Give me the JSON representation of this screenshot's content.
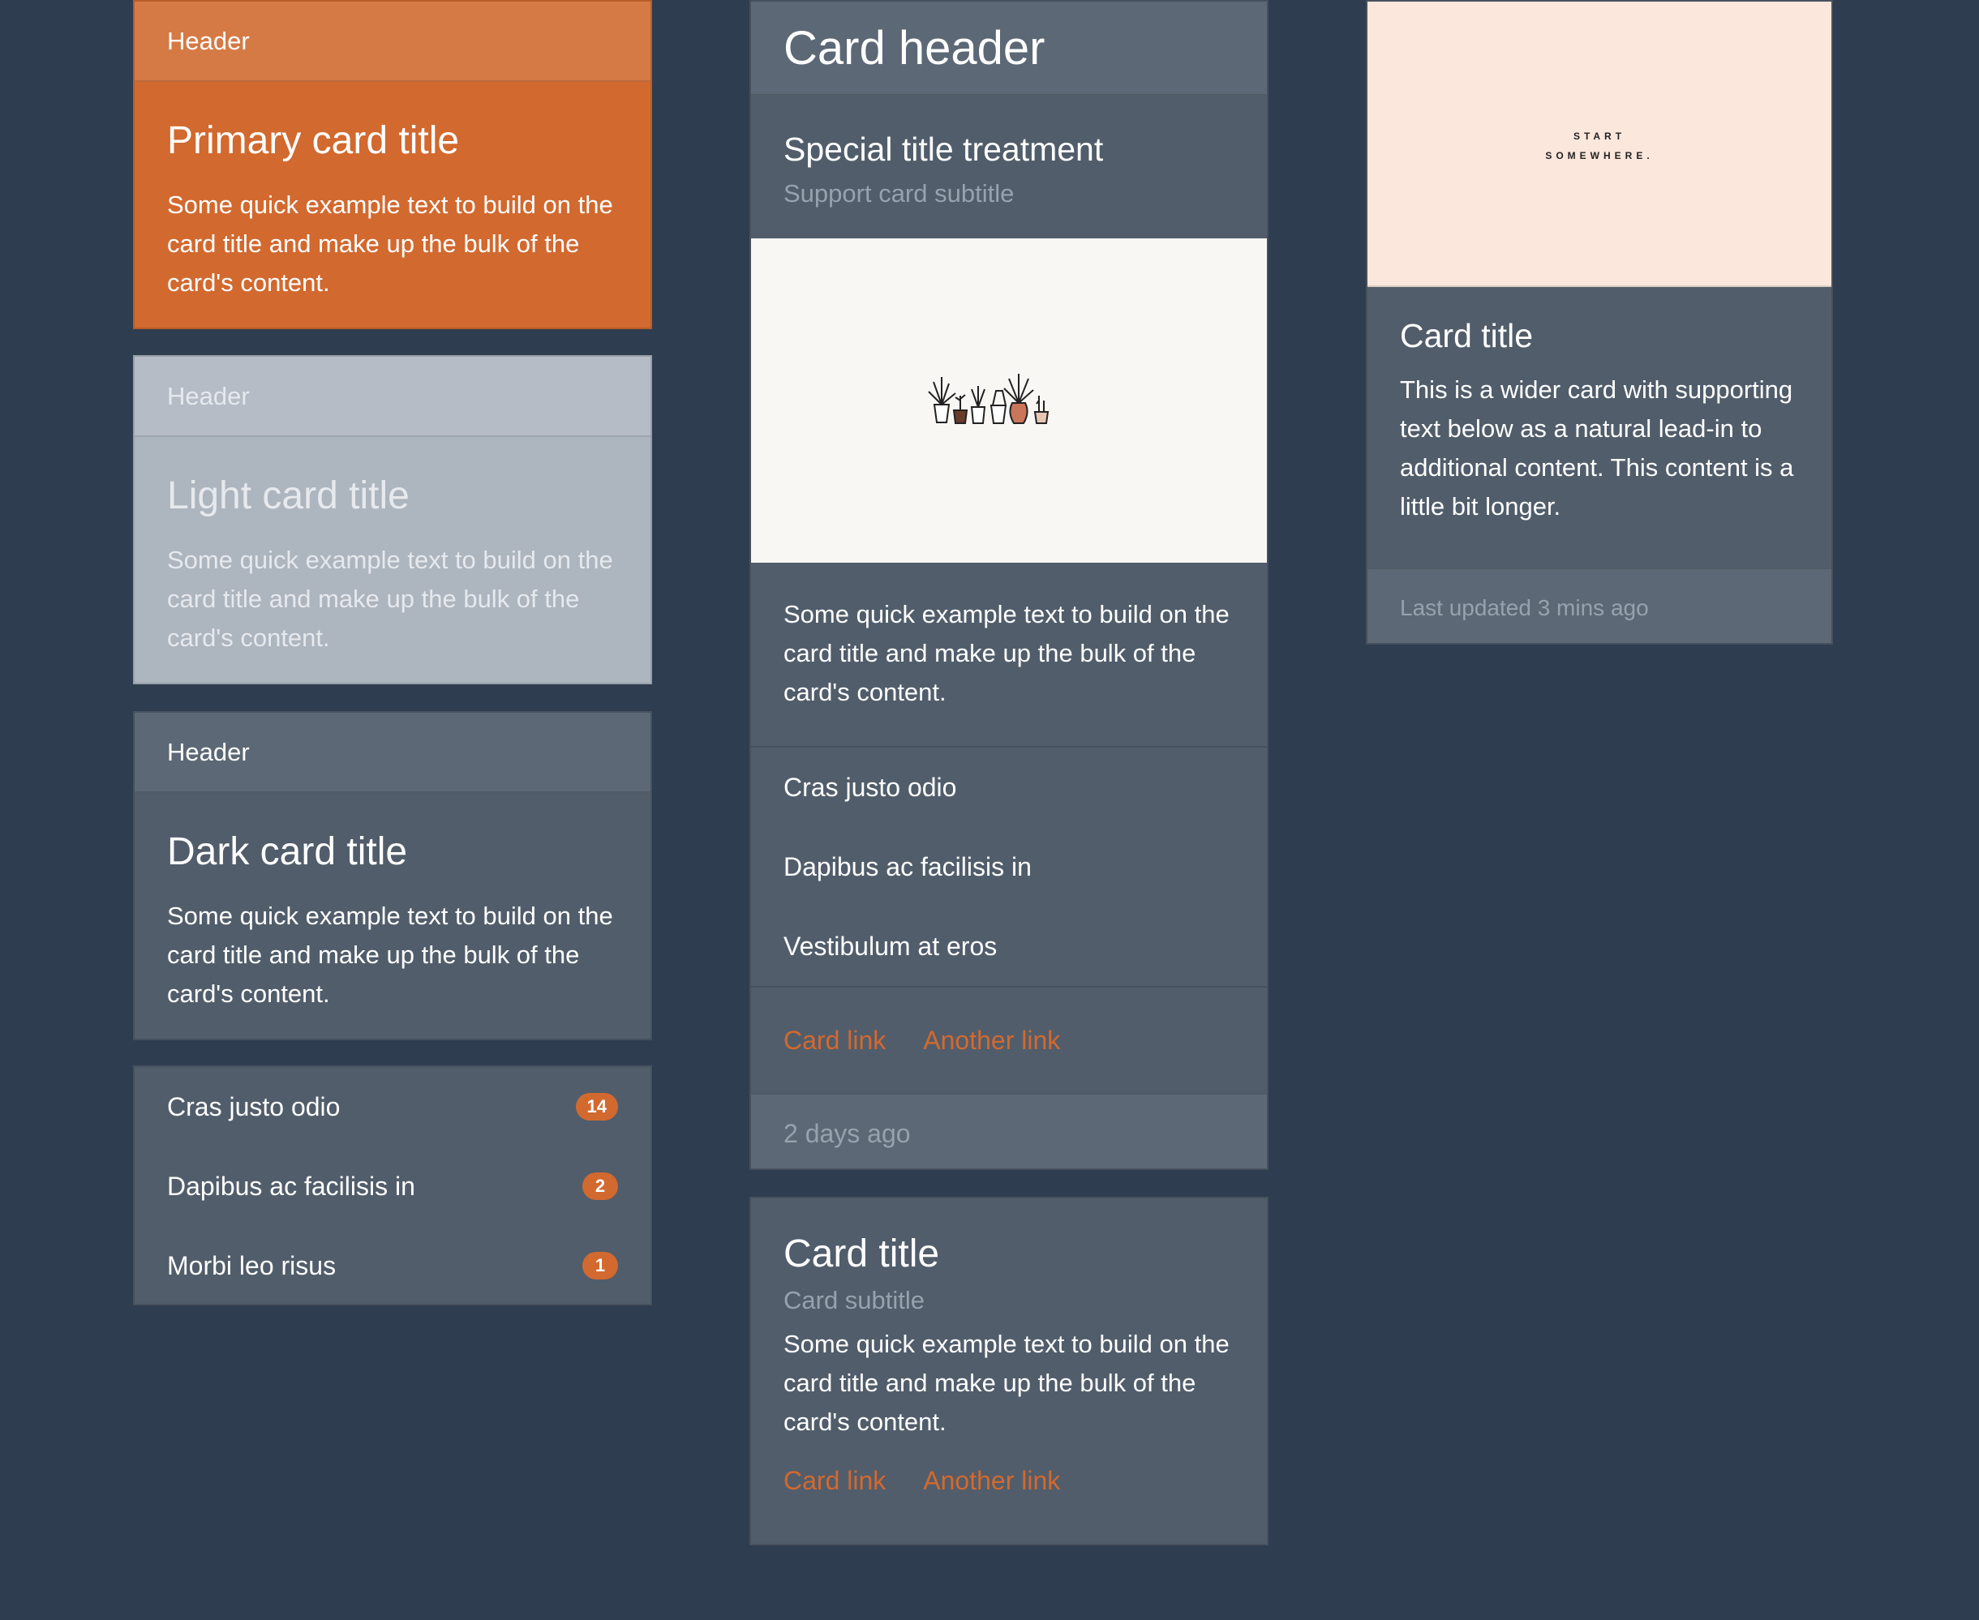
{
  "primary_card": {
    "header": "Header",
    "title": "Primary card title",
    "text": "Some quick example text to build on the card title and make up the bulk of the card's content."
  },
  "light_card": {
    "header": "Header",
    "title": "Light card title",
    "text": "Some quick example text to build on the card title and make up the bulk of the card's content."
  },
  "dark_card": {
    "header": "Header",
    "title": "Dark card title",
    "text": "Some quick example text to build on the card title and make up the bulk of the card's content."
  },
  "badge_list": [
    {
      "label": "Cras justo odio",
      "badge": "14"
    },
    {
      "label": "Dapibus ac facilisis in",
      "badge": "2"
    },
    {
      "label": "Morbi leo risus",
      "badge": "1"
    }
  ],
  "feature_card": {
    "header": "Card header",
    "title": "Special title treatment",
    "subtitle": "Support card subtitle",
    "image_alt": "plants-illustration",
    "text": "Some quick example text to build on the card title and make up the bulk of the card's content.",
    "list": [
      "Cras justo odio",
      "Dapibus ac facilisis in",
      "Vestibulum at eros"
    ],
    "link1": "Card link",
    "link2": "Another link",
    "footer": "2 days ago"
  },
  "title_card": {
    "title": "Card title",
    "subtitle": "Card subtitle",
    "text": "Some quick example text to build on the card title and make up the bulk of the card's content.",
    "link1": "Card link",
    "link2": "Another link"
  },
  "wide_card": {
    "image_text_line1": "START",
    "image_text_line2": "SOMEWHERE.",
    "title": "Card title",
    "text": "This is a wider card with supporting text below as a natural lead-in to additional content. This content is a little bit longer.",
    "footer": "Last updated 3 mins ago"
  },
  "colors": {
    "background": "#2e3d4f",
    "primary": "#d2692f",
    "card": "#515d6b",
    "light": "#adb5bf"
  }
}
